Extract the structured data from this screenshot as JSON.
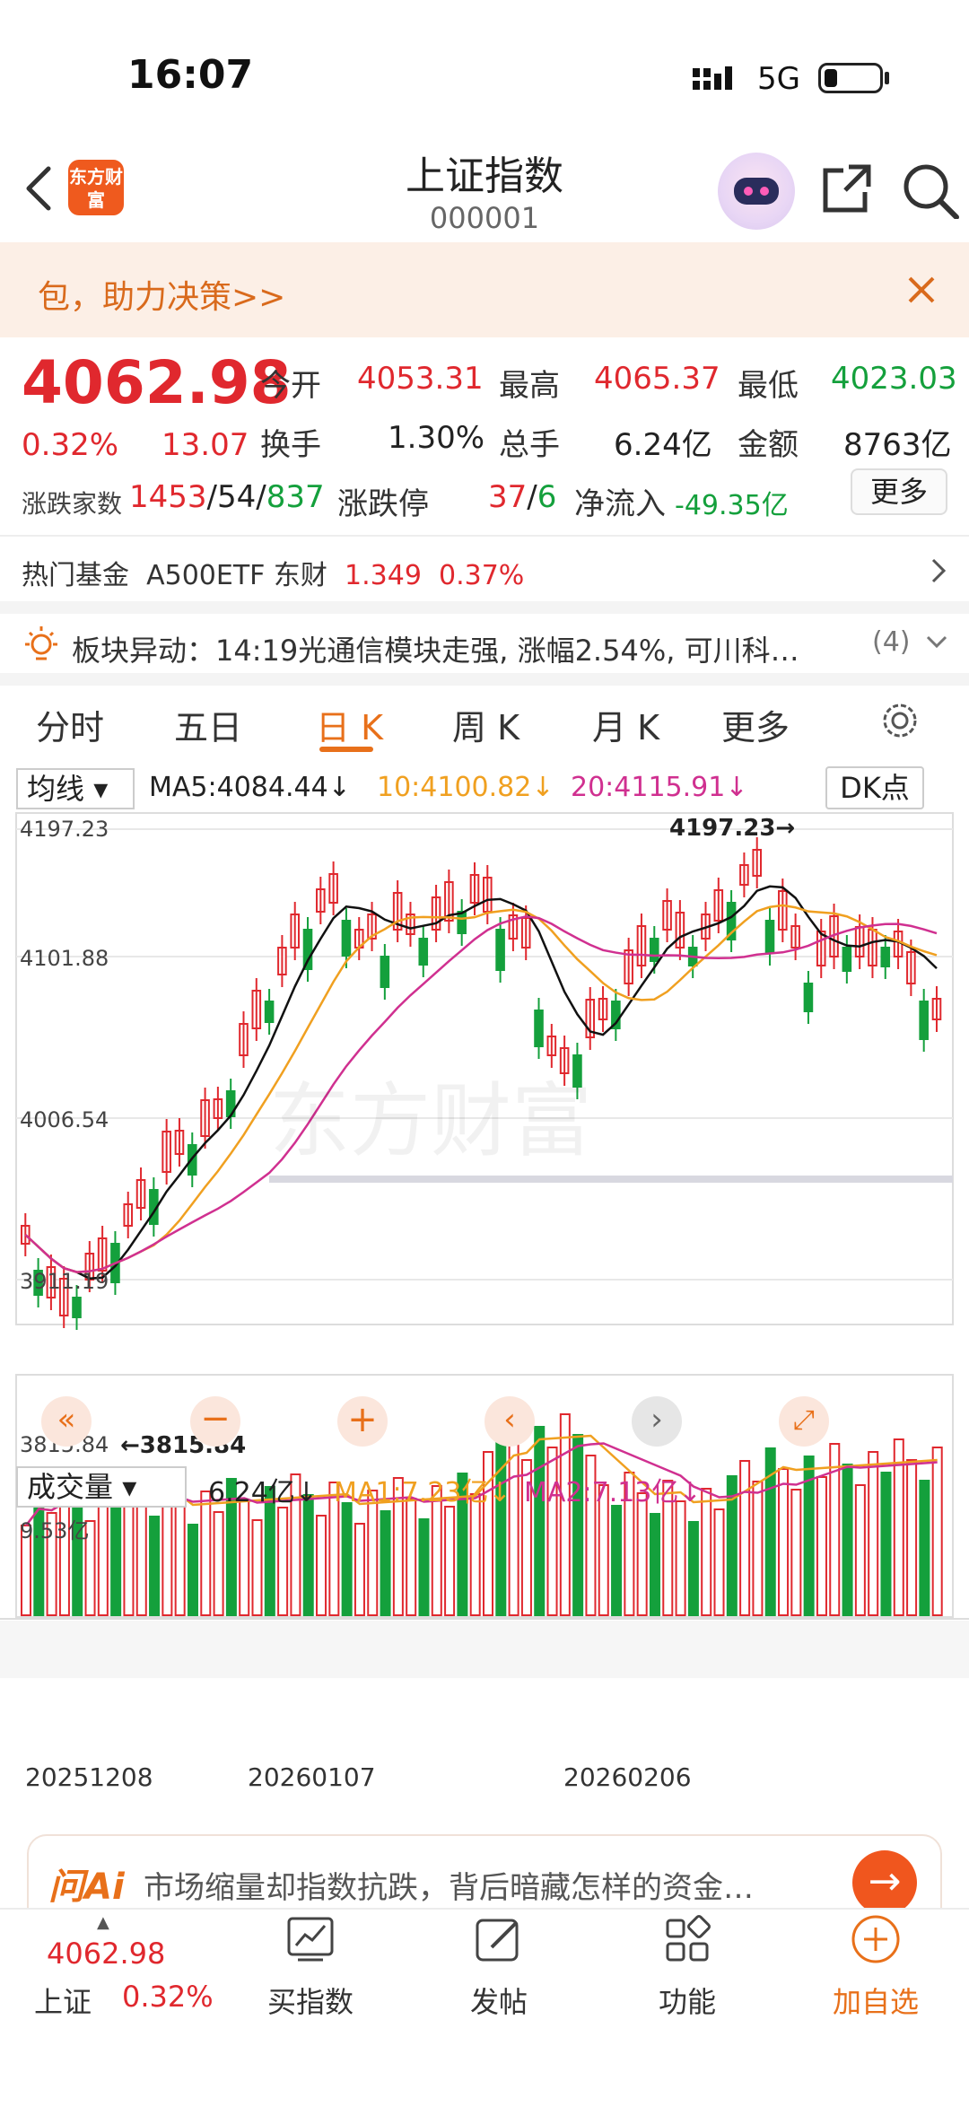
{
  "status": {
    "time": "16:07",
    "network": "5G"
  },
  "header": {
    "logo": "东方财富",
    "title": "上证指数",
    "code": "000001"
  },
  "banner": {
    "text": "包，助力决策>>"
  },
  "quote": {
    "price": "4062.98",
    "change_pct": "0.32%",
    "change": "13.07",
    "open_label": "今开",
    "open": "4053.31",
    "high_label": "最高",
    "high": "4065.37",
    "low_label": "最低",
    "low": "4023.03",
    "turnover_rate_label": "换手",
    "turnover_rate": "1.30%",
    "volume_label": "总手",
    "volume": "6.24亿",
    "amount_label": "金额",
    "amount": "8763亿",
    "breadth_label": "涨跌家数",
    "up": "1453",
    "flat": "54",
    "down": "837",
    "limit_label": "涨跌停",
    "limit_up": "37",
    "limit_down": "6",
    "netflow_label": "净流入",
    "netflow": "-49.35亿",
    "more": "更多"
  },
  "hot_fund": {
    "label": "热门基金",
    "name": "A500ETF 东财",
    "price": "1.349",
    "pct": "0.37%"
  },
  "alert": {
    "text": "板块异动：14:19光通信模块走强, 涨幅2.54%, 可川科…",
    "count": "(4)"
  },
  "tabs": [
    "分时",
    "五日",
    "日 K",
    "周 K",
    "月 K",
    "更多"
  ],
  "ma_bar": {
    "dropdown": "均线",
    "ma5": "MA5:4084.44↓",
    "ma10": "10:4100.82↓",
    "ma20": "20:4115.91↓",
    "dk": "DK点"
  },
  "vol_bar": {
    "dropdown": "成交量",
    "vol": "6.24亿↓",
    "ma1": "MA1:7.23亿↓",
    "ma2": "MA2:7.13亿↓"
  },
  "chart_data": {
    "type": "candlestick",
    "price_ticks": [
      "4197.23",
      "4101.88",
      "4006.54",
      "3911.19",
      "3815.84"
    ],
    "high_annotation": "4197.23",
    "low_annotation": "3815.84",
    "vol_tick": "9.53亿",
    "dates": [
      "20251208",
      "20260107",
      "20260206"
    ],
    "ylim": [
      3815.84,
      4197.23
    ]
  },
  "ai": {
    "logo": "问Ai",
    "text": "市场缩量却指数抗跌，背后暗藏怎样的资金…"
  },
  "nav": {
    "index_price": "4062.98",
    "index_name": "上证",
    "index_pct": "0.32%",
    "items": [
      "买指数",
      "发帖",
      "功能",
      "加自选"
    ]
  }
}
